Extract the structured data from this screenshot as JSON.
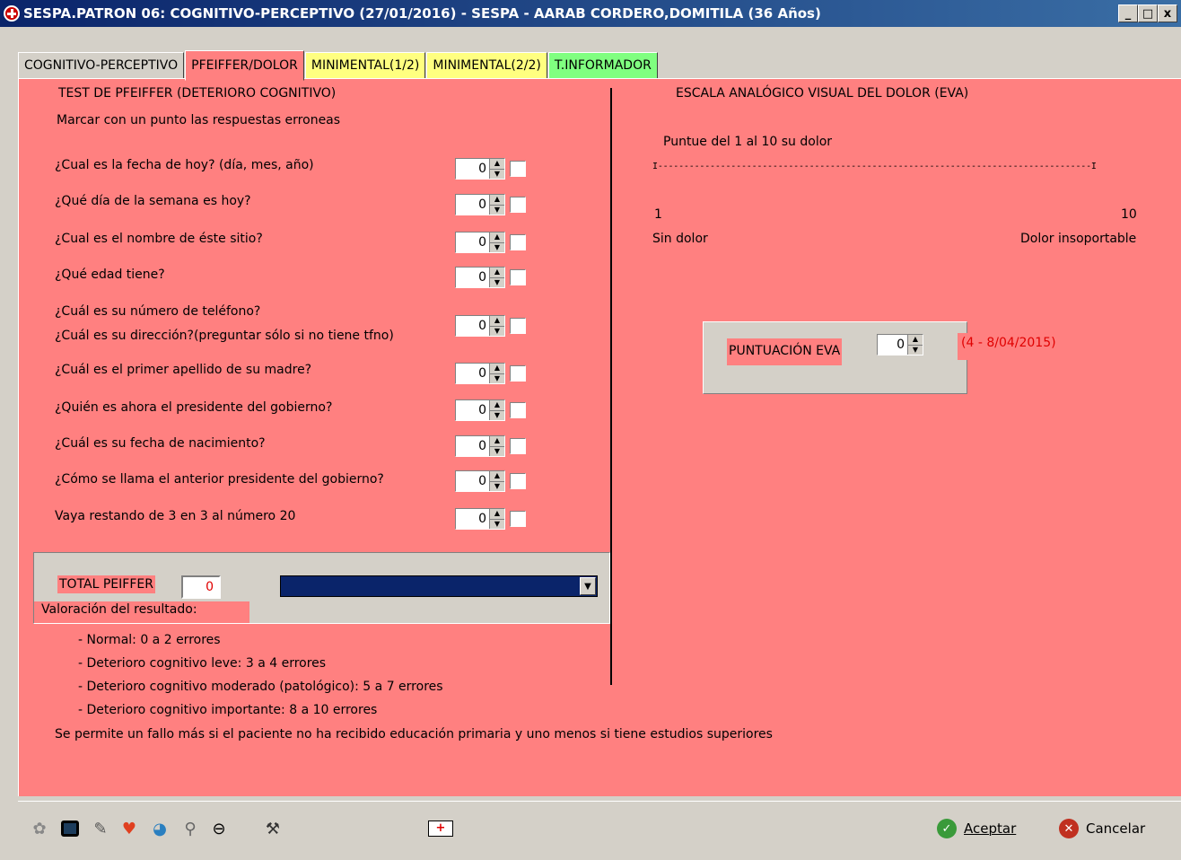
{
  "window": {
    "title": "SESPA.PATRON 06: COGNITIVO-PERCEPTIVO (27/01/2016) - SESPA - AARAB CORDERO,DOMITILA (36 Años)",
    "buttons": [
      "_",
      "□",
      "x"
    ]
  },
  "tabs": [
    {
      "label": "COGNITIVO-PERCEPTIVO",
      "color": "#d4d0c8"
    },
    {
      "label": "PFEIFFER/DOLOR",
      "color": "#d4d0c8",
      "active": true
    },
    {
      "label": "MINIMENTAL(1/2)",
      "color": "#ffff80"
    },
    {
      "label": "MINIMENTAL(2/2)",
      "color": "#ffff80"
    },
    {
      "label": "T.INFORMADOR",
      "color": "#80ff80"
    }
  ],
  "pfeiffer": {
    "title": "TEST DE PFEIFFER (DETERIORO COGNITIVO)",
    "instruction": "Marcar con un punto las respuestas erroneas",
    "questions": [
      {
        "text": "¿Cual es la fecha de hoy? (día, mes, año)",
        "value": "0"
      },
      {
        "text": "¿Qué día de la semana es hoy?",
        "value": "0"
      },
      {
        "text": "¿Cual es el nombre de éste sitio?",
        "value": "0"
      },
      {
        "text": "¿Qué edad tiene?",
        "value": "0"
      },
      {
        "text": "¿Cuál es su número de teléfono?",
        "text2": "¿Cuál es su dirección?(preguntar sólo si no tiene tfno)",
        "value": "0"
      },
      {
        "text": "¿Cuál es el primer apellido de su madre?",
        "value": "0"
      },
      {
        "text": "¿Quién es ahora el presidente del gobierno?",
        "value": "0"
      },
      {
        "text": "¿Cuál es su fecha de nacimiento?",
        "value": "0"
      },
      {
        "text": "¿Cómo se llama el anterior presidente del gobierno?",
        "value": "0"
      },
      {
        "text": "Vaya restando de 3 en 3 al número 20",
        "value": "0"
      }
    ],
    "total_label": "TOTAL PEIFFER",
    "total_value": "0",
    "valoracion_label": "Valoración del resultado:",
    "valoracion_items": [
      "- Normal: 0 a 2 errores",
      "- Deterioro cognitivo leve: 3 a 4 errores",
      "- Deterioro cognitivo moderado (patológico): 5 a 7 errores",
      "- Deterioro cognitivo importante: 8 a 10 errores"
    ],
    "note": "Se permite un fallo más si el paciente no ha recibido educación primaria y uno menos si tiene estudios superiores"
  },
  "eva": {
    "title": "ESCALA ANALÓGICO VISUAL DEL DOLOR (EVA)",
    "prompt": "Puntue del 1 al 10 su dolor",
    "scale_line": "I-----------------------------------------------------------------------------------I",
    "min_num": "1",
    "max_num": "10",
    "min_label": "Sin dolor",
    "max_label": "Dolor insoportable",
    "score_label": "PUNTUACIÓN EVA",
    "score_value": "0",
    "previous": "(4 -  8/04/2015)"
  },
  "toolbar": {
    "icons": [
      "puzzle-icon",
      "monitor-icon",
      "pencil-icon",
      "heart-icon",
      "globe-search-icon",
      "magnifier-icon",
      "eraser-icon",
      "tools-icon",
      "first-aid-icon"
    ],
    "accept_label": "Aceptar",
    "cancel_label": "Cancelar"
  }
}
